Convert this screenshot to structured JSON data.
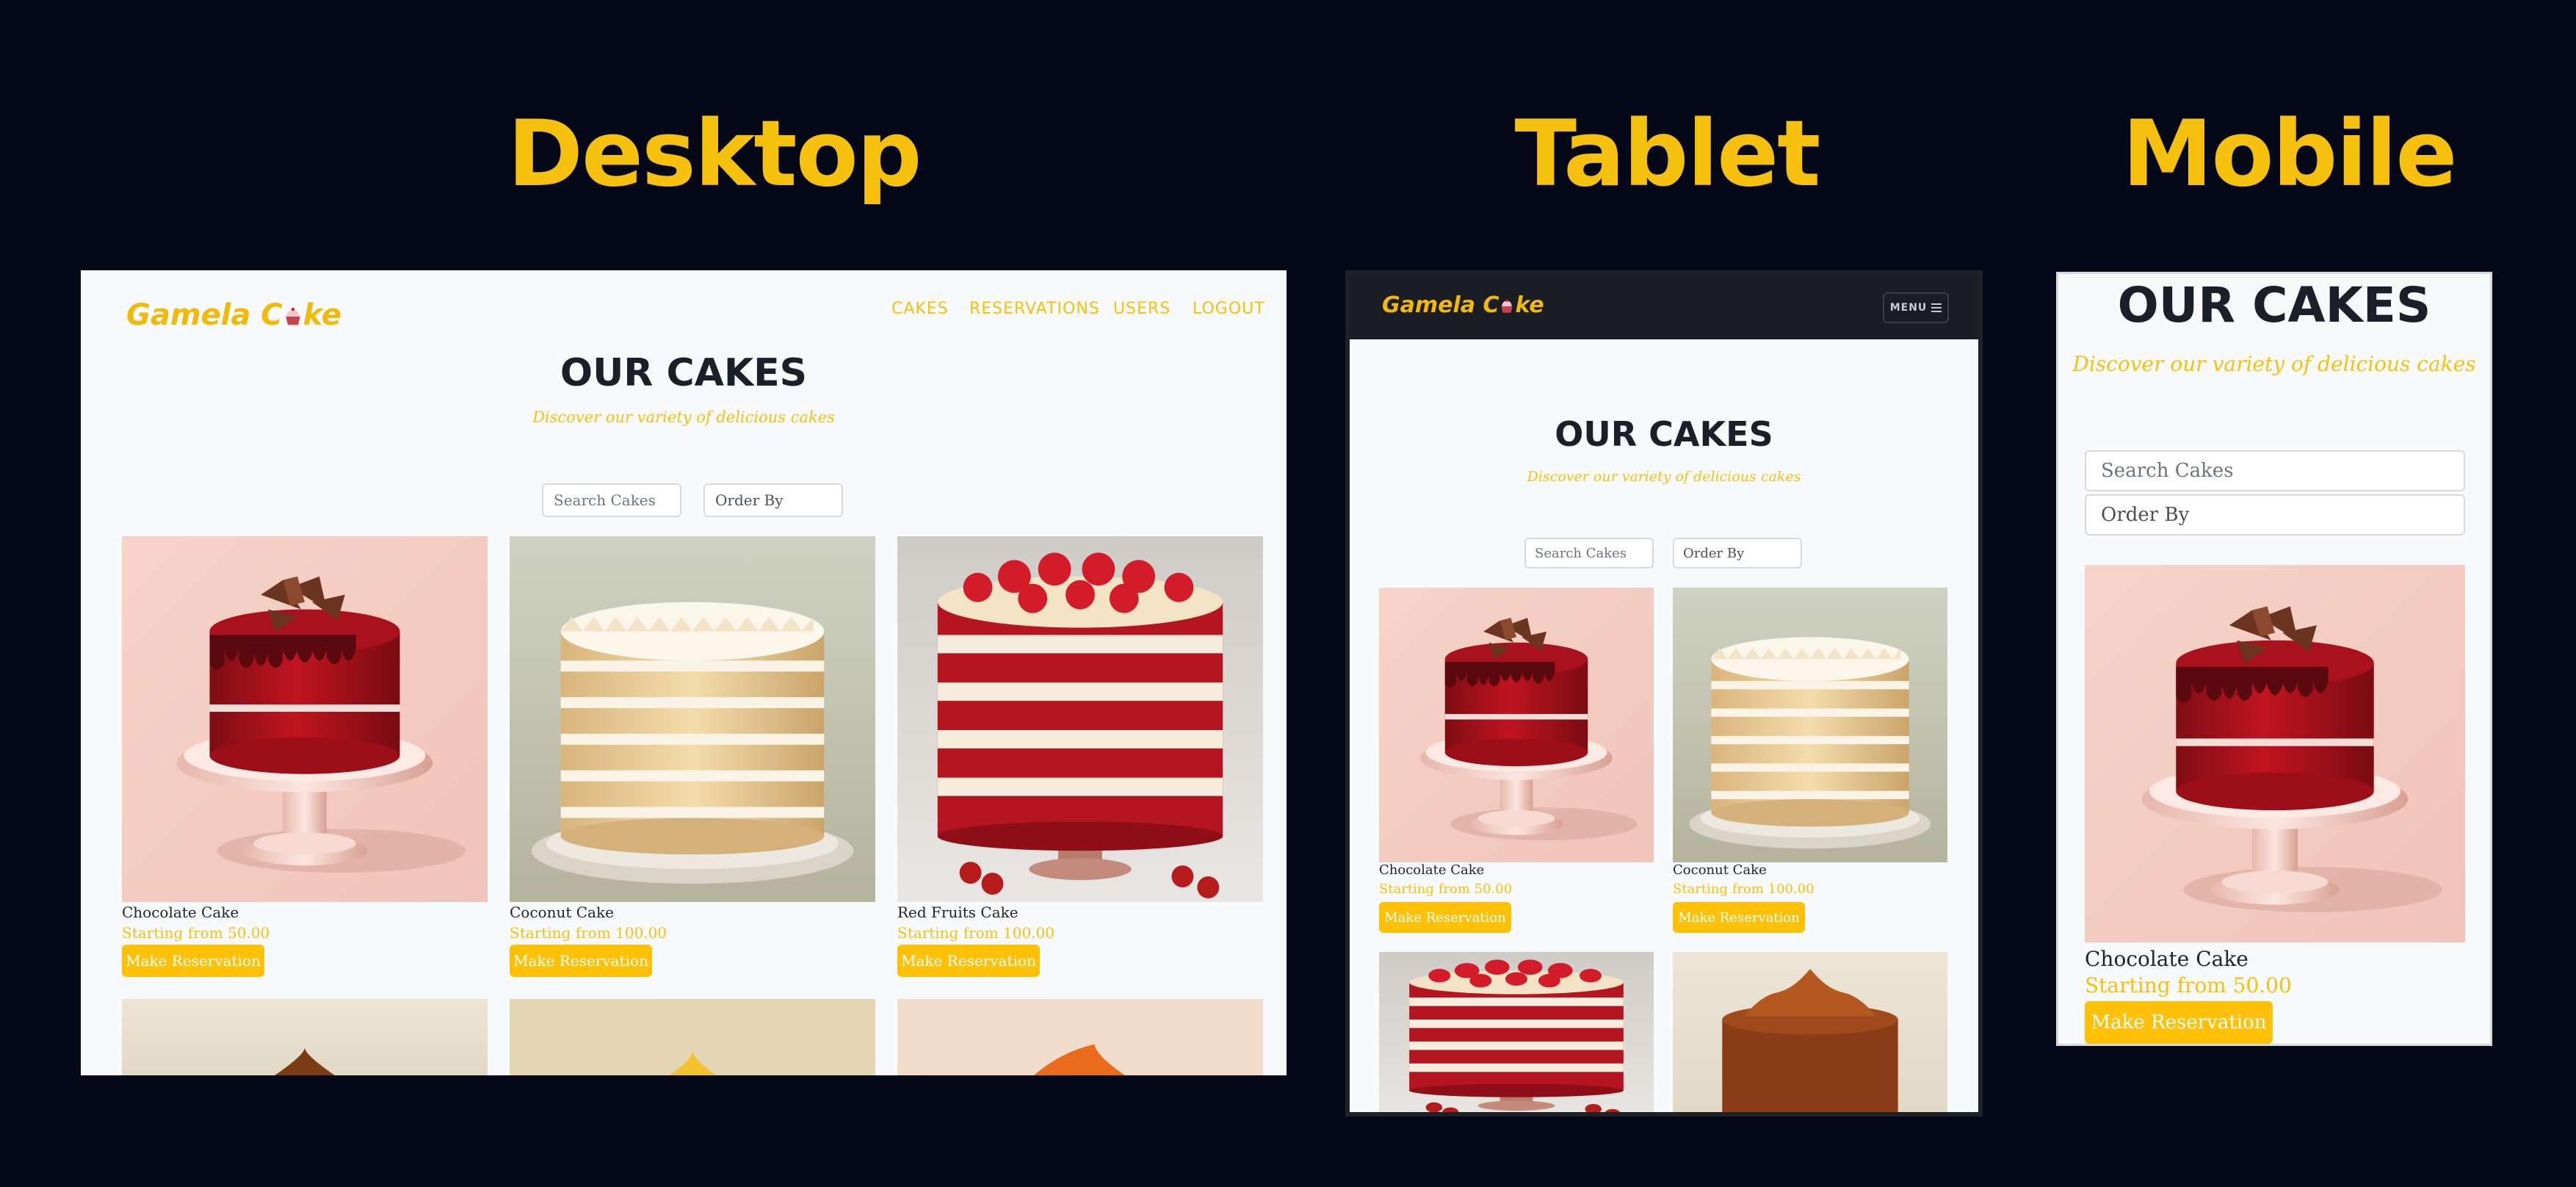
{
  "headings": {
    "desktop": "Desktop",
    "tablet": "Tablet",
    "mobile": "Mobile"
  },
  "app": {
    "logo_text": "Gamela C",
    "logo_text_end": "ke",
    "logo_icon": "cupcake-icon"
  },
  "nav": {
    "items": [
      "CAKES",
      "RESERVATIONS",
      "USERS",
      "LOGOUT"
    ],
    "menu_label": "MENU",
    "menu_icon": "hamburger-icon"
  },
  "page": {
    "title": "OUR CAKES",
    "subtitle": "Discover our variety of delicious cakes"
  },
  "filters": {
    "search_placeholder": "Search Cakes",
    "order_by_label": "Order By"
  },
  "cakes": [
    {
      "name": "Chocolate Cake",
      "price": "Starting from 50.00",
      "button": "Make Reservation"
    },
    {
      "name": "Coconut Cake",
      "price": "Starting from 100.00",
      "button": "Make Reservation"
    },
    {
      "name": "Red Fruits Cake",
      "price": "Starting from 100.00",
      "button": "Make Reservation"
    }
  ],
  "colors": {
    "accent": "#f5c10e",
    "button": "#ffc107",
    "background": "#050816",
    "page": "#f8f9fa",
    "navbar": "#1a1e22"
  }
}
